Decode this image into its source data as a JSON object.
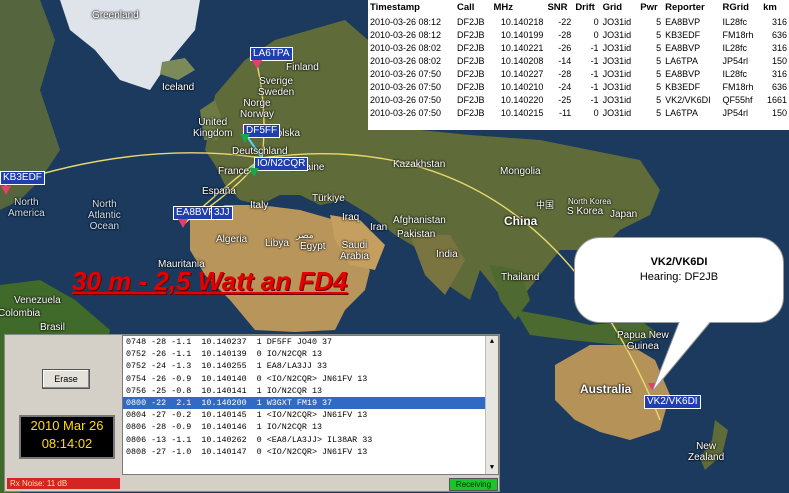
{
  "map": {
    "colors": {
      "ocean": "#1b3a5e",
      "land": "#5e6a3a",
      "desert": "#b8955a",
      "path": "#e8d870",
      "selected_path": "#5ad2e8"
    },
    "countries": {
      "greenland": "Greenland",
      "iceland": "Iceland",
      "finland": "Finland",
      "sverige": "Sverige\nSweden",
      "norge": "Norge\nNorway",
      "uk": "United\nKingdom",
      "polska": "Polska",
      "deutschland": "Deutschland",
      "ukraine": "Ukraine",
      "france": "France",
      "italy": "Italy",
      "espana": "España",
      "turkiye": "Türkiye",
      "kazakhstan": "Kazakhstan",
      "mongolia": "Mongolia",
      "china": "China",
      "china_cn": "中国",
      "korea": "S Korea",
      "north_korea": "North Korea",
      "japan": "Japan",
      "iraq": "Iraq",
      "iran": "Iran",
      "afghanistan": "Afghanistan",
      "pakistan": "Pakistan",
      "india": "India",
      "thailand": "Thailand",
      "algeria": "Algeria",
      "libya": "Libya",
      "egypt": "Egypt",
      "egypt_ar": "مصر",
      "saudi": "Saudi\nArabia",
      "mauritania": "Mauritania",
      "venezuela": "Venezuela",
      "colombia": "Colombia",
      "brazil": "Brasil",
      "papua": "Papua New\nGuinea",
      "australia": "Australia",
      "new_zealand": "New\nZealand",
      "north_atlantic": "North\nAtlantic\nOcean",
      "north_america": "North\nAmerica"
    },
    "stations": {
      "la6tpa": "LA6TPA",
      "df5ff": "DF5FF",
      "io_n2cqr": "IO/N2CQR",
      "ea8bvp": "EA8BVP",
      "la3jj": "3JJ",
      "kb3edf": "KB3EDF",
      "vk2": "VK2/VK6DI"
    },
    "banner": "30 m - 2,5 Watt an FD4"
  },
  "bubble": {
    "call": "VK2/VK6DI",
    "hearing": "Hearing: DF2JB"
  },
  "spots": {
    "headers": [
      "Timestamp",
      "Call",
      "MHz",
      "SNR",
      "Drift",
      "Grid",
      "Pwr",
      "Reporter",
      "RGrid",
      "km"
    ],
    "rows": [
      [
        "2010-03-26 08:12",
        "DF2JB",
        "10.140218",
        "-22",
        "0",
        "JO31id",
        "5",
        "EA8BVP",
        "IL28fc",
        "316"
      ],
      [
        "2010-03-26 08:12",
        "DF2JB",
        "10.140199",
        "-28",
        "0",
        "JO31id",
        "5",
        "KB3EDF",
        "FM18rh",
        "636"
      ],
      [
        "2010-03-26 08:02",
        "DF2JB",
        "10.140221",
        "-26",
        "-1",
        "JO31id",
        "5",
        "EA8BVP",
        "IL28fc",
        "316"
      ],
      [
        "2010-03-26 08:02",
        "DF2JB",
        "10.140208",
        "-14",
        "-1",
        "JO31id",
        "5",
        "LA6TPA",
        "JP54rl",
        "150"
      ],
      [
        "2010-03-26 07:50",
        "DF2JB",
        "10.140227",
        "-28",
        "-1",
        "JO31id",
        "5",
        "EA8BVP",
        "IL28fc",
        "316"
      ],
      [
        "2010-03-26 07:50",
        "DF2JB",
        "10.140210",
        "-24",
        "-1",
        "JO31id",
        "5",
        "KB3EDF",
        "FM18rh",
        "636"
      ],
      [
        "2010-03-26 07:50",
        "DF2JB",
        "10.140220",
        "-25",
        "-1",
        "JO31id",
        "5",
        "VK2/VK6DI",
        "QF55hf",
        "1661"
      ],
      [
        "2010-03-26 07:50",
        "DF2JB",
        "10.140215",
        "-11",
        "0",
        "JO31id",
        "5",
        "LA6TPA",
        "JP54rl",
        "150"
      ]
    ]
  },
  "panel": {
    "erase_label": "Erase",
    "clock_date": "2010 Mar 26",
    "clock_time": "08:14:02",
    "rx_status": "Rx Noise: 11 dB",
    "receiving_label": "Receiving",
    "rx_color": "#d42424",
    "receiving_color": "#17c52c",
    "decodes": [
      {
        "text": "0748 -28 -1.1  10.140237  1 DF5FF JO40 37",
        "selected": false
      },
      {
        "text": "0752 -26 -1.1  10.140139  0 IO/N2CQR 13",
        "selected": false
      },
      {
        "text": "0752 -24 -1.3  10.140255  1 EA8/LA3JJ 33",
        "selected": false
      },
      {
        "text": "0754 -26 -0.9  10.140140  0 <IO/N2CQR> JN61FV 13",
        "selected": false
      },
      {
        "text": "0756 -25 -0.8  10.140141  1 IO/N2CQR 13",
        "selected": false
      },
      {
        "text": "0800 -22  2.1  10.140200  1 W3GXT FM19 37",
        "selected": true
      },
      {
        "text": "0804 -27 -0.2  10.140145  1 <IO/N2CQR> JN61FV 13",
        "selected": false
      },
      {
        "text": "0806 -28 -0.9  10.140146  1 IO/N2CQR 13",
        "selected": false
      },
      {
        "text": "0806 -13 -1.1  10.140262  0 <EA8/LA3JJ> IL38AR 33",
        "selected": false
      },
      {
        "text": "0808 -27 -1.0  10.140147  0 <IO/N2CQR> JN61FV 13",
        "selected": false
      }
    ]
  }
}
